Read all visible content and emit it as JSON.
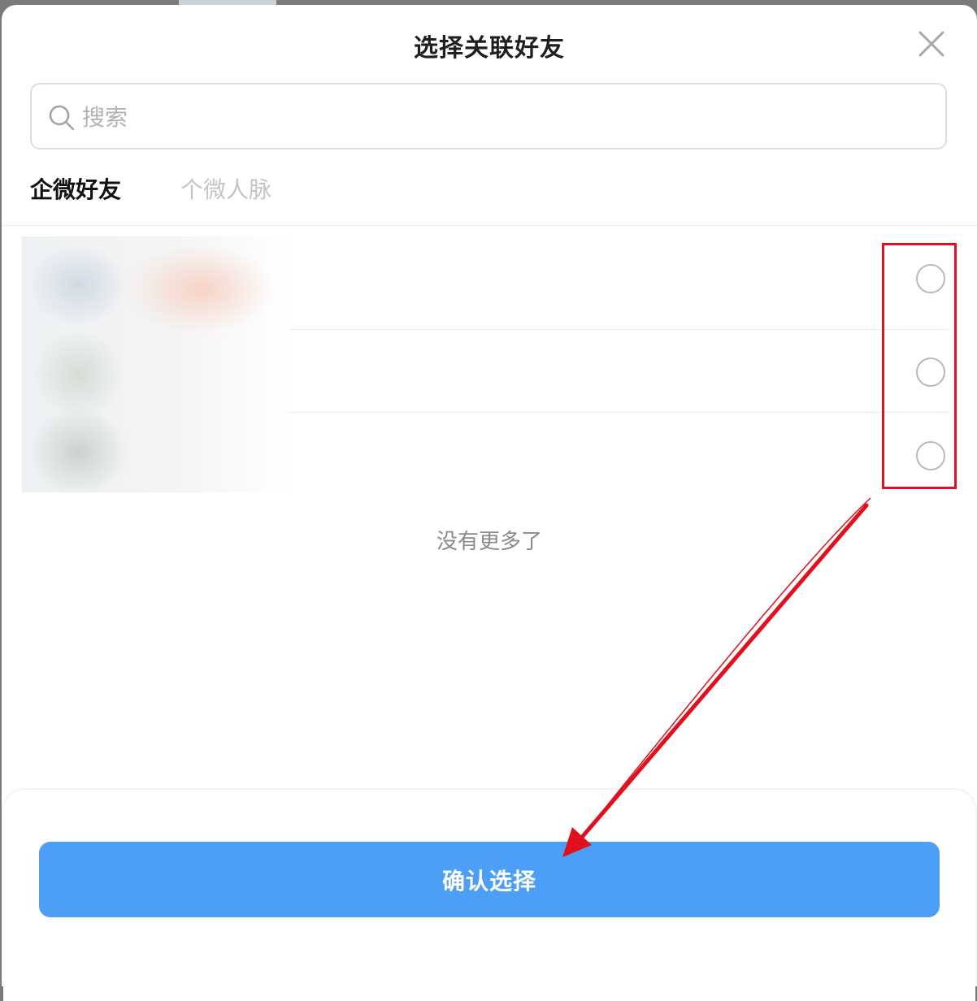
{
  "dialog": {
    "title": "选择关联好友"
  },
  "search": {
    "placeholder": "搜索",
    "value": ""
  },
  "tabs": [
    {
      "label": "企微好友",
      "active": true
    },
    {
      "label": "个微人脉",
      "active": false
    }
  ],
  "friends": [
    {
      "selected": false
    },
    {
      "selected": false
    },
    {
      "selected": false
    }
  ],
  "list": {
    "end_text": "没有更多了"
  },
  "footer": {
    "confirm_label": "确认选择"
  },
  "colors": {
    "accent": "#4d9ef7",
    "annotation": "#e0101e"
  },
  "icons": {
    "close": "close-icon",
    "search": "search-icon"
  }
}
